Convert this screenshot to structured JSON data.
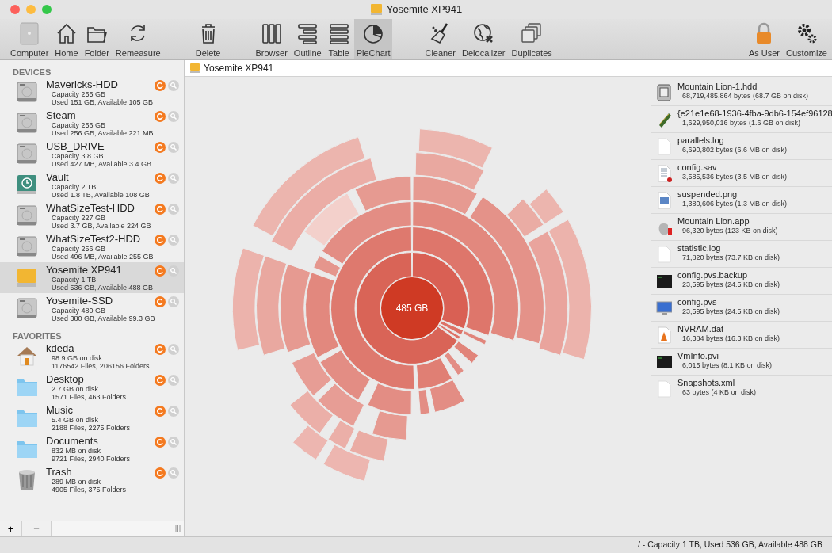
{
  "window": {
    "title": "Yosemite XP941"
  },
  "toolbar": {
    "groups": [
      {
        "items": [
          {
            "label": "Computer",
            "kind": "computer",
            "selected": false
          },
          {
            "label": "Home",
            "kind": "home",
            "selected": false
          },
          {
            "label": "Folder",
            "kind": "folder",
            "selected": false
          },
          {
            "label": "Remeasure",
            "kind": "remeasure",
            "selected": false
          }
        ]
      },
      {
        "items": [
          {
            "label": "Delete",
            "kind": "trash",
            "selected": false
          }
        ]
      },
      {
        "items": [
          {
            "label": "Browser",
            "kind": "browser",
            "selected": false
          },
          {
            "label": "Outline",
            "kind": "outline",
            "selected": false
          },
          {
            "label": "Table",
            "kind": "table",
            "selected": false
          },
          {
            "label": "PieChart",
            "kind": "pie",
            "selected": true
          }
        ]
      },
      {
        "items": [
          {
            "label": "Cleaner",
            "kind": "broom",
            "selected": false
          },
          {
            "label": "Delocalizer",
            "kind": "globe",
            "selected": false
          },
          {
            "label": "Duplicates",
            "kind": "duplicates",
            "selected": false
          }
        ]
      },
      {
        "items": [
          {
            "label": "As User",
            "kind": "lock",
            "selected": false
          },
          {
            "label": "Customize",
            "kind": "gears",
            "selected": false
          }
        ]
      }
    ]
  },
  "sidebar": {
    "sections": [
      {
        "title": "DEVICES",
        "items": [
          {
            "name": "Mavericks-HDD",
            "line_1": "Capacity 255 GB",
            "line_2": "Used 151 GB, Available 105 GB",
            "kind": "hdd",
            "selected": false
          },
          {
            "name": "Steam",
            "line_1": "Capacity 256 GB",
            "line_2": "Used 256 GB, Available 221 MB",
            "kind": "hdd",
            "selected": false
          },
          {
            "name": "USB_DRIVE",
            "line_1": "Capacity 3.8 GB",
            "line_2": "Used 427 MB, Available 3.4 GB",
            "kind": "hdd",
            "selected": false
          },
          {
            "name": "Vault",
            "line_1": "Capacity 2 TB",
            "line_2": "Used 1.8 TB, Available 108 GB",
            "kind": "timemachine",
            "selected": false
          },
          {
            "name": "WhatSizeTest-HDD",
            "line_1": "Capacity 227 GB",
            "line_2": "Used 3.7 GB, Available 224 GB",
            "kind": "hdd",
            "selected": false
          },
          {
            "name": "WhatSizeTest2-HDD",
            "line_1": "Capacity 256 GB",
            "line_2": "Used 496 MB, Available 255 GB",
            "kind": "hdd",
            "selected": false
          },
          {
            "name": "Yosemite XP941",
            "line_1": "Capacity 1 TB",
            "line_2": "Used 536 GB, Available 488 GB",
            "kind": "drive",
            "selected": true
          },
          {
            "name": "Yosemite-SSD",
            "line_1": "Capacity 480 GB",
            "line_2": "Used 380 GB, Available 99.3 GB",
            "kind": "hdd",
            "selected": false
          }
        ]
      },
      {
        "title": "FAVORITES",
        "items": [
          {
            "name": "kdeda",
            "line_1": "98.9 GB on disk",
            "line_2": "1176542 Files, 206156 Folders",
            "kind": "home",
            "selected": false
          },
          {
            "name": "Desktop",
            "line_1": "2.7 GB on disk",
            "line_2": "1571 Files, 463 Folders",
            "kind": "folder",
            "selected": false
          },
          {
            "name": "Music",
            "line_1": "5.4 GB on disk",
            "line_2": "2188 Files, 2275 Folders",
            "kind": "folder",
            "selected": false
          },
          {
            "name": "Documents",
            "line_1": "832 MB on disk",
            "line_2": "9721 Files, 2940 Folders",
            "kind": "folder",
            "selected": false
          },
          {
            "name": "Trash",
            "line_1": "289 MB on disk",
            "line_2": "4905 Files, 375 Folders",
            "kind": "trash",
            "selected": false
          }
        ]
      }
    ],
    "add_button": "+",
    "remove_button": "−"
  },
  "path_bar": {
    "label": "Yosemite XP941"
  },
  "chart": {
    "center_label": "485 GB"
  },
  "files": [
    {
      "name": "Mountain Lion-1.hdd",
      "detail": "68,719,485,864 bytes (68.7 GB on disk)",
      "kind": "disk"
    },
    {
      "name": "{e21e1e68-1936-4fba-9db6-154ef96128",
      "detail": "1,629,950,016 bytes (1.6 GB on disk)",
      "kind": "chip"
    },
    {
      "name": "parallels.log",
      "detail": "6,690,802 bytes (6.6 MB on disk)",
      "kind": "doc"
    },
    {
      "name": "config.sav",
      "detail": "3,585,536 bytes (3.5 MB on disk)",
      "kind": "sheet"
    },
    {
      "name": "suspended.png",
      "detail": "1,380,606 bytes (1.3 MB on disk)",
      "kind": "image"
    },
    {
      "name": "Mountain Lion.app",
      "detail": "96,320 bytes (123 KB on disk)",
      "kind": "app"
    },
    {
      "name": "statistic.log",
      "detail": "71,820 bytes (73.7 KB on disk)",
      "kind": "doc"
    },
    {
      "name": "config.pvs.backup",
      "detail": "23,595 bytes (24.5 KB on disk)",
      "kind": "terminal"
    },
    {
      "name": "config.pvs",
      "detail": "23,595 bytes (24.5 KB on disk)",
      "kind": "monitor"
    },
    {
      "name": "NVRAM.dat",
      "detail": "16,384 bytes (16.3 KB on disk)",
      "kind": "cone"
    },
    {
      "name": "VmInfo.pvi",
      "detail": "6,015 bytes (8.1 KB on disk)",
      "kind": "terminal"
    },
    {
      "name": "Snapshots.xml",
      "detail": "63 bytes (4 KB on disk)",
      "kind": "doc"
    }
  ],
  "status_bar": "/ - Capacity 1 TB, Used 536 GB, Available 488 GB"
}
